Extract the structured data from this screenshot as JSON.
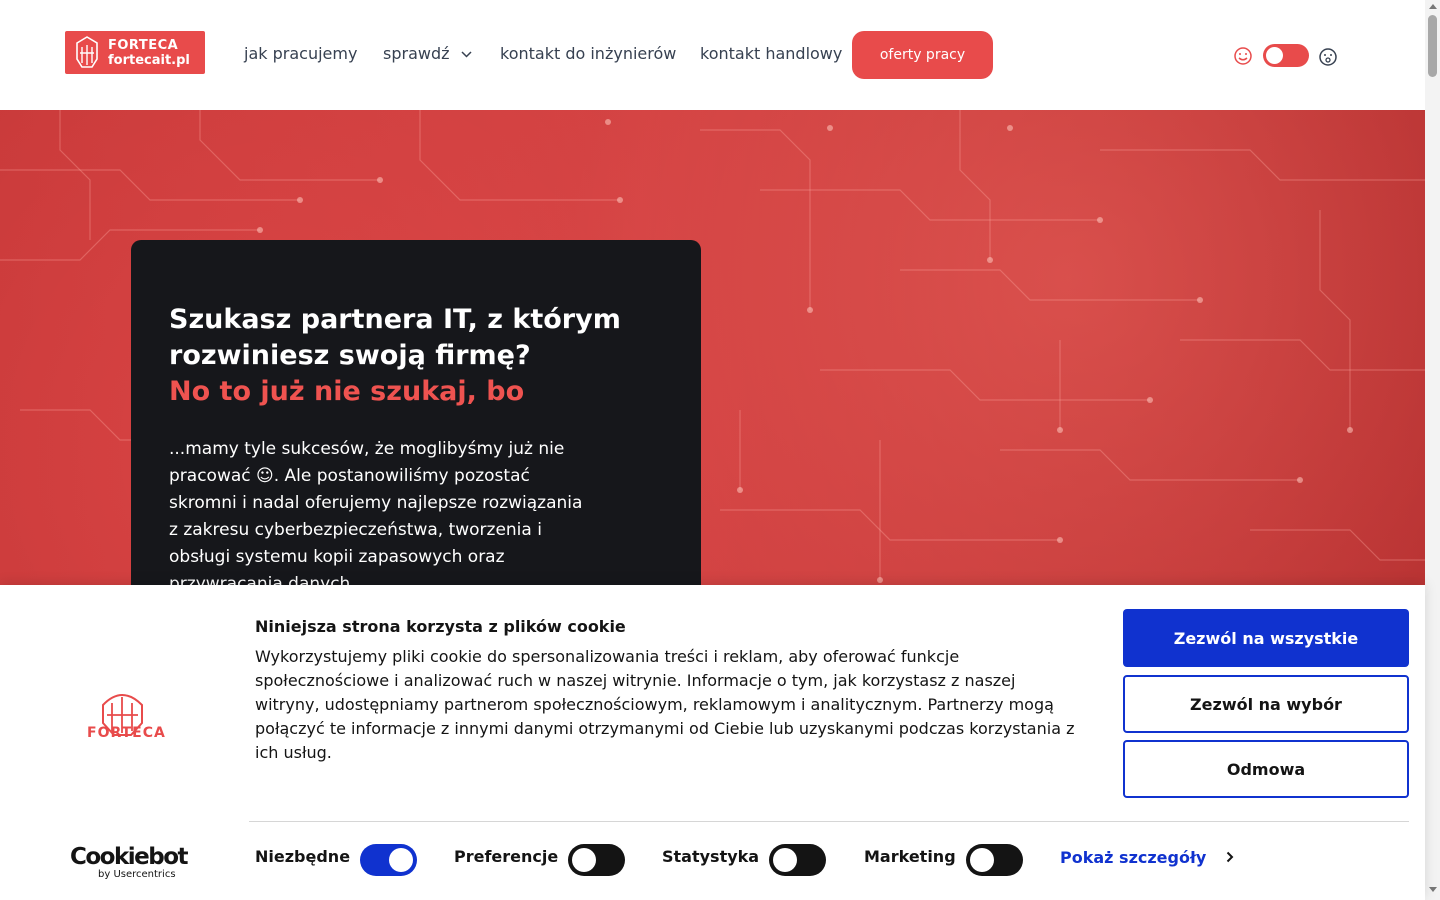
{
  "brand": {
    "name": "FORTECA",
    "domain": "fortecait.pl"
  },
  "nav": {
    "items": [
      {
        "label": "jak pracujemy"
      },
      {
        "label": "sprawdź"
      },
      {
        "label": "kontakt do inżynierów"
      },
      {
        "label": "kontakt handlowy"
      }
    ],
    "cta_label": "oferty pracy"
  },
  "hero": {
    "heading": "Szukasz partnera IT, z którym rozwiniesz swoją firmę?",
    "heading_accent": "No to już nie szukaj, bo",
    "body": "...mamy tyle sukcesów, że moglibyśmy już nie pracować ☺. Ale postanowiliśmy pozostać skromni i nadal oferujemy najlepsze rozwiązania z zakresu cyberbezpieczeństwa, tworzenia i obsługi systemu kopii zapasowych oraz przywracania danych."
  },
  "cookie": {
    "logo_text": "FORTECA",
    "title": "Niniejsza strona korzysta z plików cookie",
    "text": "Wykorzystujemy pliki cookie do spersonalizowania treści i reklam, aby oferować funkcje społecznościowe i analizować ruch w naszej witrynie. Informacje o tym, jak korzystasz z naszej witryny, udostępniamy partnerom społecznościowym, reklamowym i analitycznym. Partnerzy mogą połączyć te informacje z innymi danymi otrzymanymi od Ciebie lub uzyskanymi podczas korzystania z ich usług.",
    "allow_all": "Zezwól na wszystkie",
    "allow_selection": "Zezwól na wybór",
    "deny": "Odmowa",
    "categories": [
      {
        "label": "Niezbędne",
        "enabled": true
      },
      {
        "label": "Preferencje",
        "enabled": false
      },
      {
        "label": "Statystyka",
        "enabled": false
      },
      {
        "label": "Marketing",
        "enabled": false
      }
    ],
    "show_details": "Pokaż szczegóły",
    "provider": "Cookiebot",
    "provider_sub": "by Usercentrics"
  },
  "colors": {
    "brand_red": "#e84b4b",
    "cookie_blue": "#1032cf",
    "card_bg": "#16171b"
  },
  "icons": {
    "theme_light": "smile-icon",
    "theme_dark": "moon-face-icon",
    "nav_dropdown": "chevron-down-icon",
    "details_arrow": "chevron-right-icon"
  }
}
